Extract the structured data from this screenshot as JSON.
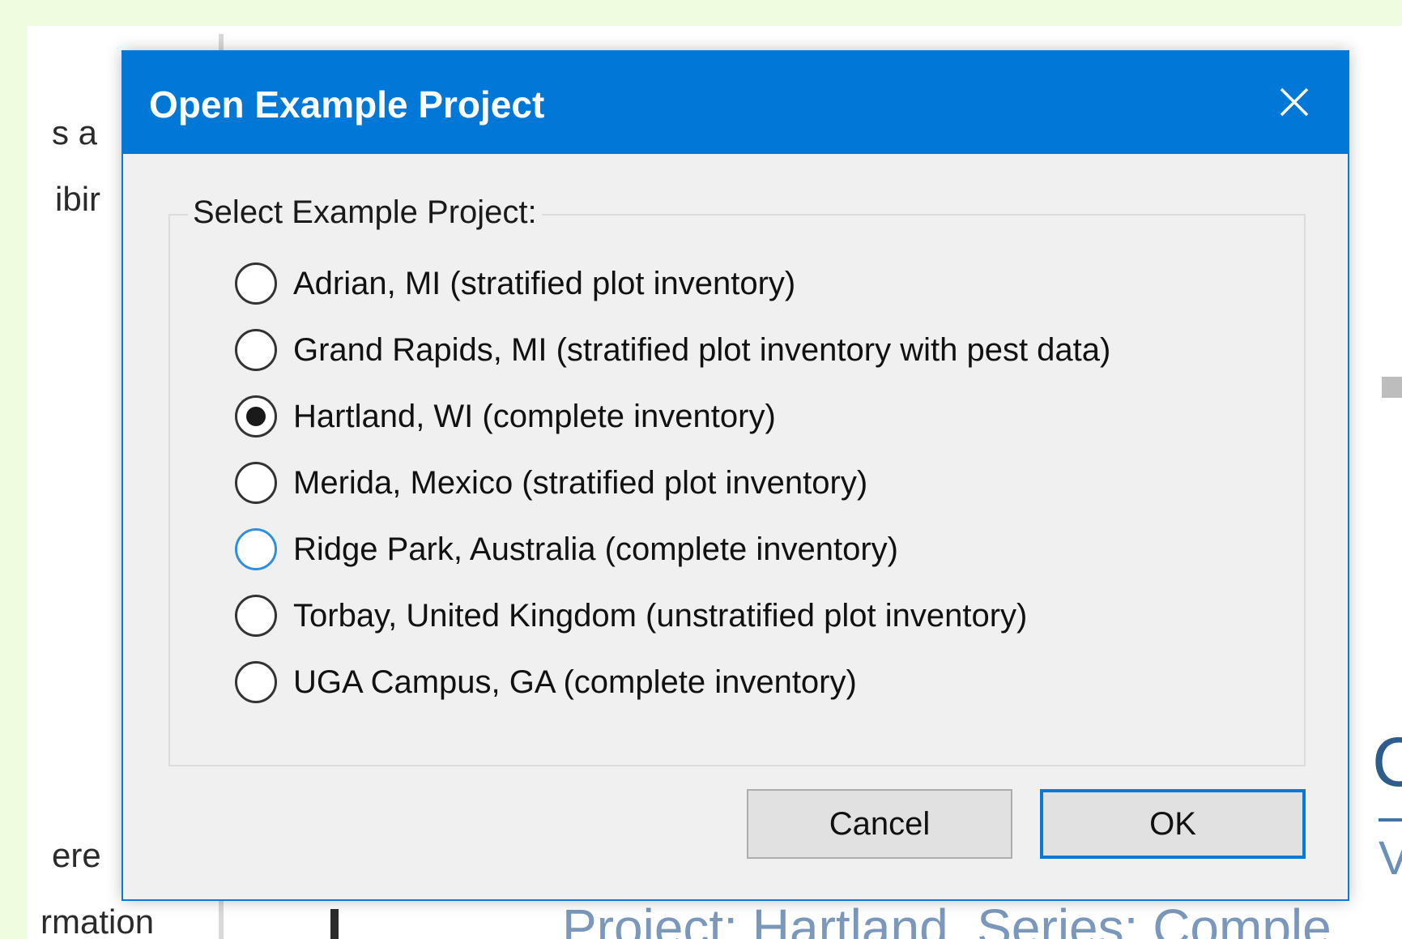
{
  "background": {
    "fragments": [
      "s a",
      "ibir",
      "ere",
      "rmation"
    ],
    "big_letter": "C",
    "side_letter": "V",
    "subtitle": "Project: Hartland, Series: Comple"
  },
  "dialog": {
    "title": "Open Example Project",
    "close_icon": "close-icon",
    "group_label": "Select Example Project:",
    "options": [
      {
        "label": "Adrian, MI (stratified plot inventory)",
        "selected": false
      },
      {
        "label": "Grand Rapids, MI (stratified plot inventory with pest data)",
        "selected": false
      },
      {
        "label": "Hartland, WI (complete inventory)",
        "selected": true
      },
      {
        "label": "Merida, Mexico (stratified plot inventory)",
        "selected": false
      },
      {
        "label": "Ridge Park, Australia (complete inventory)",
        "selected": false,
        "hovered": true
      },
      {
        "label": "Torbay, United Kingdom (unstratified plot inventory)",
        "selected": false
      },
      {
        "label": "UGA Campus, GA (complete inventory)",
        "selected": false
      }
    ],
    "cancel_label": "Cancel",
    "ok_label": "OK"
  },
  "colors": {
    "titlebar": "#0078d7",
    "dialog_bg": "#f0f0f0",
    "page_bg": "#eefce0",
    "hover_radio": "#2f8fe0"
  }
}
